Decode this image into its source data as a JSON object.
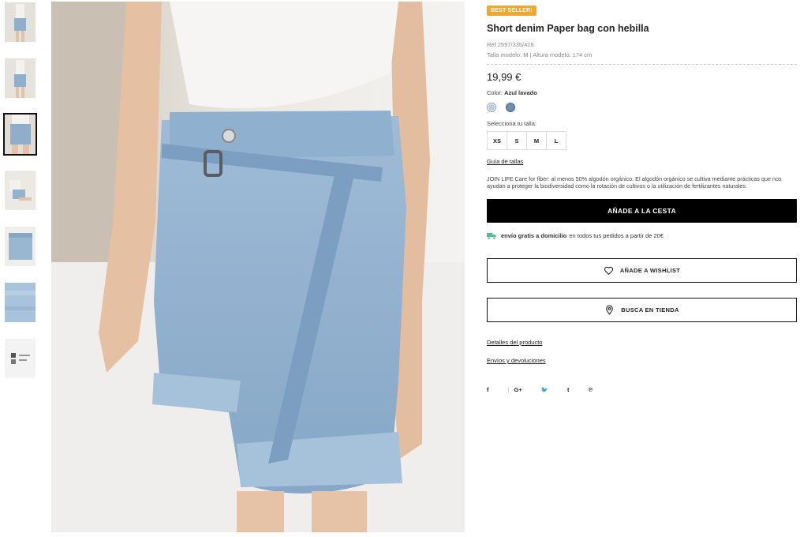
{
  "badge": "BEST SELLER!",
  "product": {
    "title": "Short denim Paper bag con hebilla",
    "ref": "Ref 2597/335/428",
    "model_info": "Talla modelo: M | Altura modelo: 174 cm",
    "price": "19,99 €"
  },
  "color": {
    "label": "Color:",
    "value": "Azul lavado",
    "swatches": [
      "#b9ccd9",
      "#6f8fae"
    ]
  },
  "sizes": {
    "label": "Selecciona tu talla:",
    "options": [
      "XS",
      "S",
      "M",
      "L"
    ]
  },
  "size_guide": "Guía de tallas",
  "description": "JOIN LIFE Care for fiber: al menos 50% algodón orgánico. El algodón orgánico se cultiva mediante prácticas que nos ayudan a proteger la biodiversidad como la rotación de cultivos o la utilización de fertilizantes naturales.",
  "add_to_cart": "AÑADE A LA CESTA",
  "shipping": {
    "bold": "envío gratis a domicilio",
    "rest": "en todos tus pedidos a partir de 20€"
  },
  "wishlist_button": "AÑADE A WISHLIST",
  "store_button": "BUSCA EN TIENDA",
  "links": {
    "details": "Detalles del producto",
    "returns": "Envíos y devoluciones"
  },
  "social": {
    "facebook": "f",
    "separator": "|",
    "googleplus": "G+",
    "twitter": "🐦",
    "tumblr": "t",
    "pinterest": "℗"
  },
  "thumbnails": [
    "front-view",
    "front-view-2",
    "side-view",
    "seated-view",
    "flat-lay",
    "fabric-closeup",
    "label-tag"
  ]
}
